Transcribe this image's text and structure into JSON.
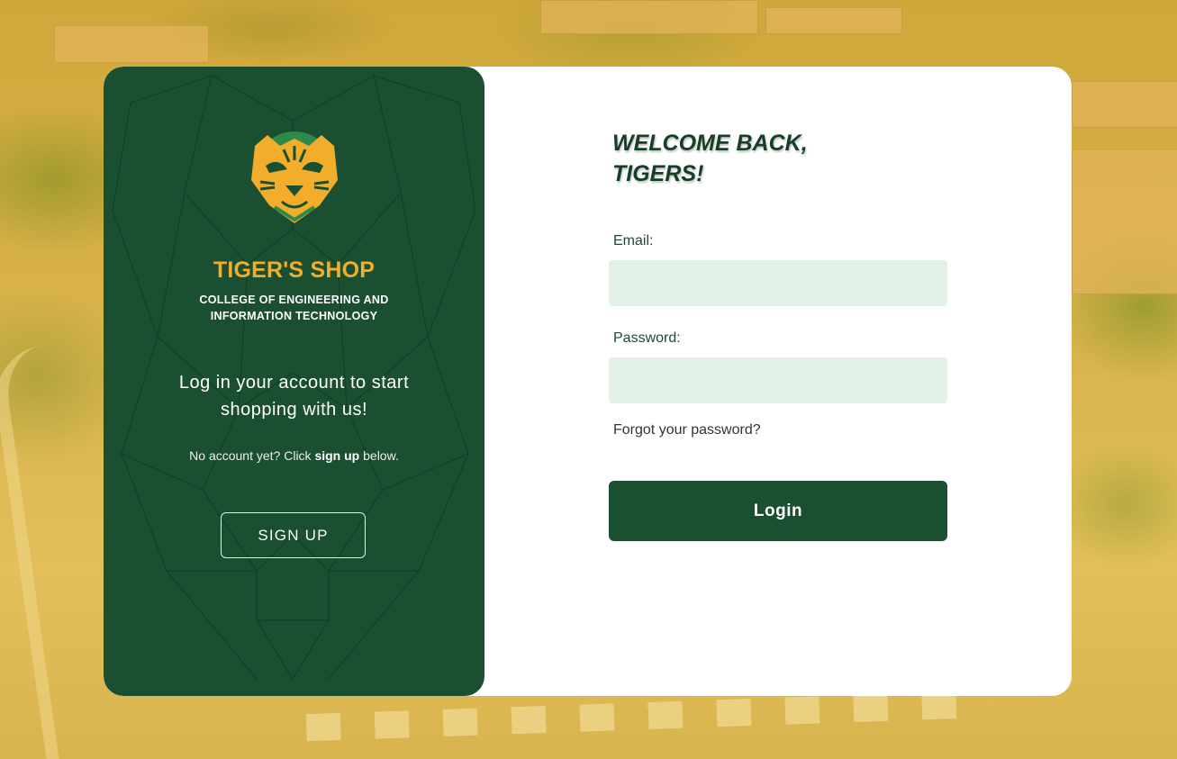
{
  "brand": {
    "logo_icon": "tiger-head-icon",
    "title": "TIGER'S SHOP",
    "subtitle_line1": "COLLEGE OF ENGINEERING AND",
    "subtitle_line2": "INFORMATION TECHNOLOGY"
  },
  "promo": {
    "tagline": "Log in your account to start shopping with us!",
    "no_account_prefix": "No account yet? Click ",
    "no_account_link": "sign up",
    "no_account_suffix": " below.",
    "signup_label": "SIGN UP"
  },
  "login_form": {
    "welcome_line1": "WELCOME BACK,",
    "welcome_line2": "TIGERS!",
    "email_label": "Email:",
    "email_value": "",
    "password_label": "Password:",
    "password_value": "",
    "forgot_password": "Forgot your password?",
    "login_label": "Login"
  },
  "colors": {
    "primary_green": "#1b4f31",
    "brand_orange": "#f2ad2a",
    "input_background": "#e3f2e6",
    "background_tint": "#d8b24a"
  }
}
